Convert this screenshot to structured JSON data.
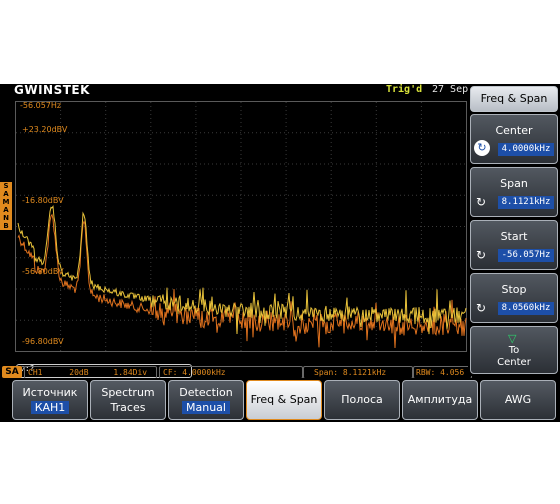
{
  "header": {
    "logo": "GWINSTEK",
    "trigger_status": "Trig'd",
    "date": "27 Sep"
  },
  "plot": {
    "freq_label": "-56.057Hz",
    "y_labels": [
      "+23.20dBV",
      "-16.80dBV",
      "-56.80dBV",
      "-96.80dBV"
    ],
    "side_letters": [
      "S",
      "A",
      "M",
      "A",
      "N",
      "B"
    ]
  },
  "right_panel": {
    "title": "Freq & Span",
    "buttons": [
      {
        "label": "Center",
        "value": "4.0000kHz"
      },
      {
        "label": "Span",
        "value": "8.1121kHz"
      },
      {
        "label": "Start",
        "value": "-56.057Hz"
      },
      {
        "label": "Stop",
        "value": "8.0560kHz"
      }
    ],
    "to_center": {
      "line1": "To",
      "line2": "Center"
    }
  },
  "cursor_text": "▽:?",
  "status": {
    "tag": "SA",
    "channel": "CH1",
    "scale": "20dB",
    "div": "1.84Div",
    "cf": "CF: 4.0000kHz",
    "span": "Span: 8.1121kHz",
    "rbw": "RBW: 4.056"
  },
  "softkeys": [
    {
      "l1": "Источник",
      "l2": "КАН1"
    },
    {
      "l1": "Spectrum",
      "l2": "Traces"
    },
    {
      "l1": "Detection",
      "l2": "Manual"
    },
    {
      "l1": "Freq & Span",
      "l2": ""
    },
    {
      "l1": "Полоса",
      "l2": ""
    },
    {
      "l1": "Амплитуда",
      "l2": ""
    },
    {
      "l1": "AWG",
      "l2": ""
    }
  ],
  "colors": {
    "accent": "#e08a1e",
    "trace_yellow": "#e8c23a",
    "trace_orange": "#e0721e",
    "selected_blue": "#1d4fa8"
  }
}
